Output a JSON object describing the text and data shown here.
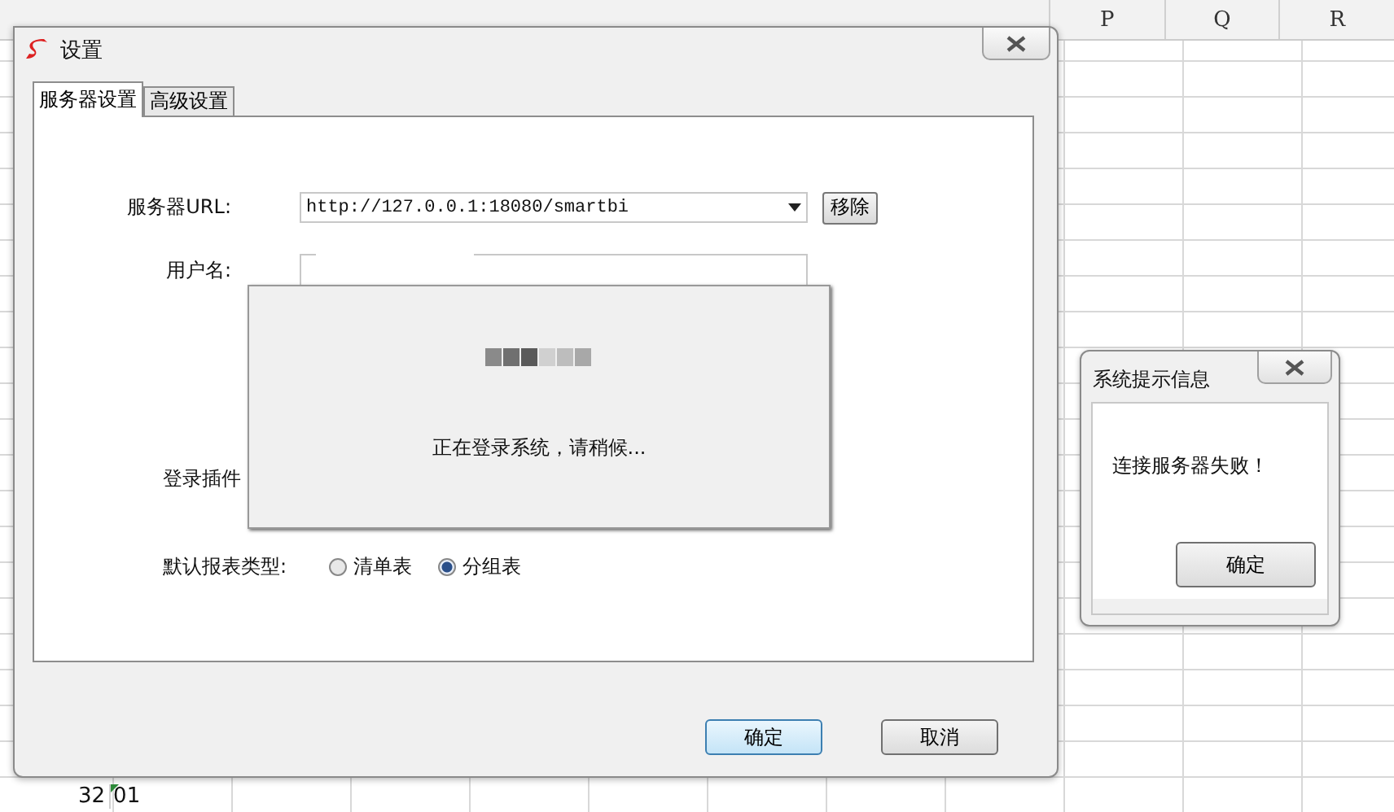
{
  "spreadsheet": {
    "column_headers": [
      "P",
      "Q",
      "R"
    ],
    "cells": [
      {
        "text": "32",
        "kind": "number"
      },
      {
        "text": "01",
        "kind": "text-number"
      }
    ]
  },
  "settings_dialog": {
    "title": "设置",
    "tabs": [
      {
        "label": "服务器设置",
        "selected": true
      },
      {
        "label": "高级设置",
        "selected": false
      }
    ],
    "server_url": {
      "label": "服务器URL:",
      "value": "http://127.0.0.1:18080/smartbi",
      "button": "移除"
    },
    "username": {
      "label": "用户名:"
    },
    "login_plugin": {
      "label": "登录插件"
    },
    "report_type": {
      "label": "默认报表类型:",
      "options": [
        {
          "label": "清单表",
          "selected": false
        },
        {
          "label": "分组表",
          "selected": true
        }
      ]
    },
    "buttons": [
      {
        "label": "确定",
        "default": true
      },
      {
        "label": "取消",
        "default": false
      }
    ]
  },
  "loading_popup": {
    "message": "正在登录系统，请稍候..."
  },
  "message_box": {
    "title": "系统提示信息",
    "message": "连接服务器失败！",
    "button": "确定"
  }
}
